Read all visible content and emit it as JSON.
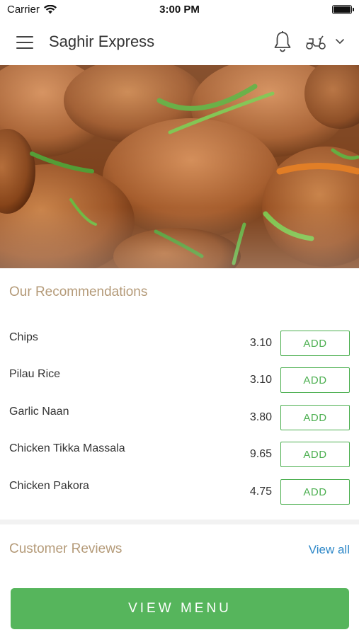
{
  "status_bar": {
    "carrier": "Carrier",
    "time": "3:00 PM"
  },
  "header": {
    "title": "Saghir Express",
    "icons": [
      "menu-icon",
      "bell-icon",
      "scooter-icon",
      "chevron-down-icon"
    ]
  },
  "hero": {
    "image": "food-photo"
  },
  "recommendations": {
    "title": "Our Recommendations",
    "items": [
      {
        "name": "Chips",
        "price": "3.10",
        "add_label": "ADD"
      },
      {
        "name": "Pilau Rice",
        "price": "3.10",
        "add_label": "ADD"
      },
      {
        "name": "Garlic Naan",
        "price": "3.80",
        "add_label": "ADD"
      },
      {
        "name": "Chicken Tikka Massala",
        "price": "9.65",
        "add_label": "ADD"
      },
      {
        "name": "Chicken Pakora",
        "price": "4.75",
        "add_label": "ADD"
      }
    ]
  },
  "reviews": {
    "title": "Customer Reviews",
    "view_all_label": "View all"
  },
  "footer": {
    "view_menu_label": "VIEW MENU"
  },
  "colors": {
    "accent_green": "#4caf50",
    "section_title": "#b49a78",
    "link_blue": "#2e88c8"
  }
}
